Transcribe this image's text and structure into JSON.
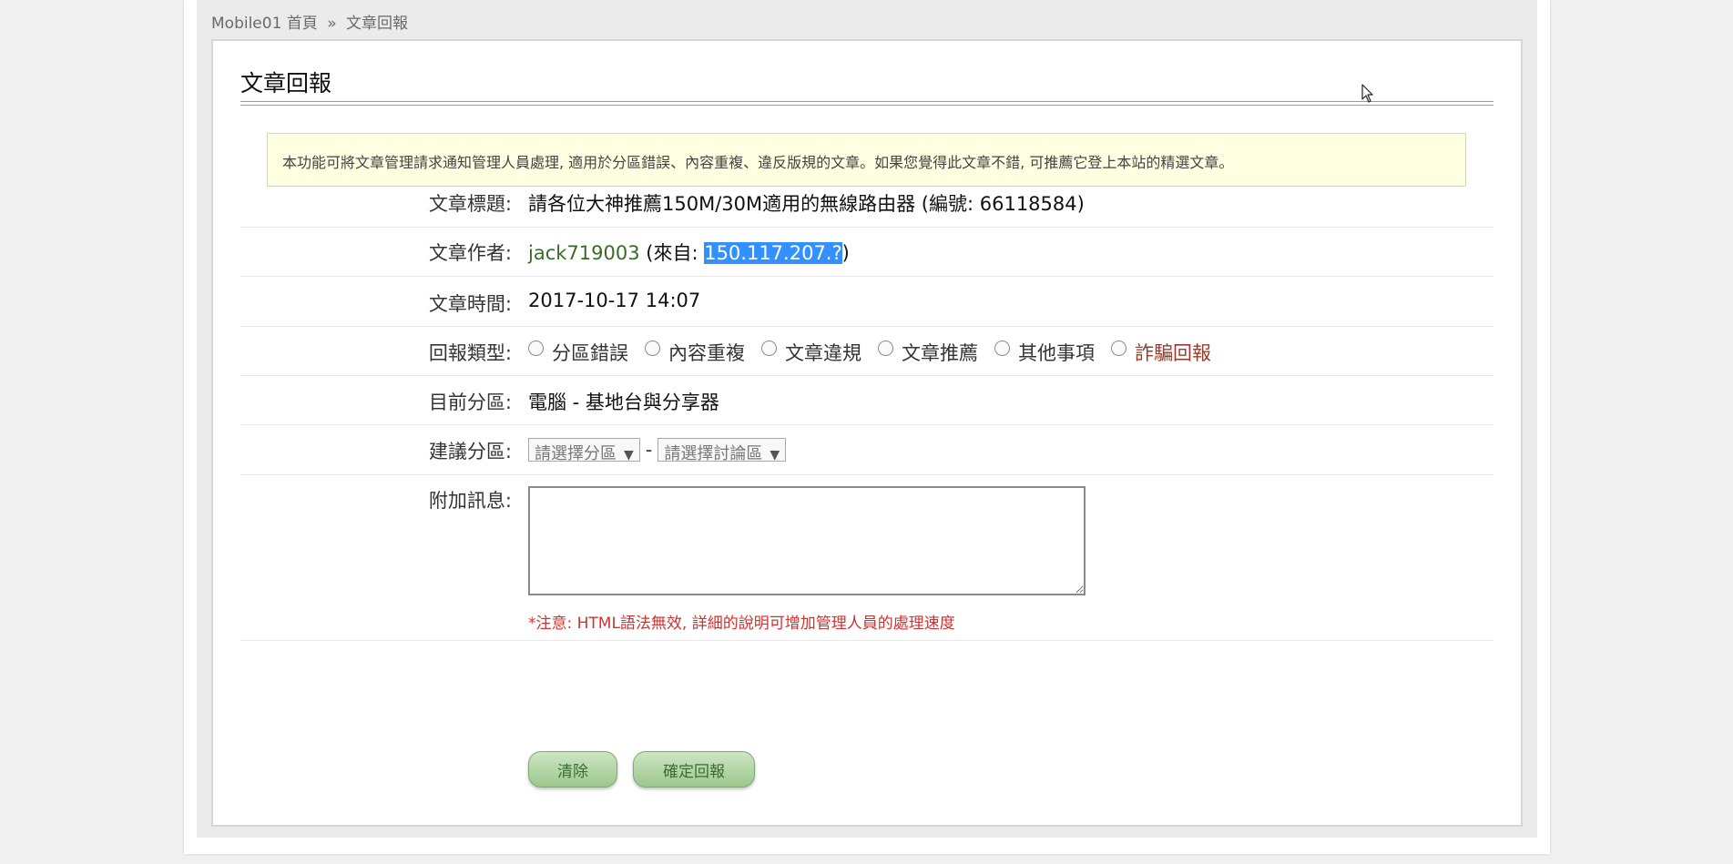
{
  "breadcrumb": {
    "site": "Mobile01",
    "home": "首頁",
    "separator": "»",
    "current": "文章回報"
  },
  "card": {
    "title": "文章回報",
    "notice": "本功能可將文章管理請求通知管理人員處理, 適用於分區錯誤、內容重複、違反版規的文章。如果您覺得此文章不錯, 可推薦它登上本站的精選文章。"
  },
  "fields": {
    "title_label": "文章標題:",
    "title_value": "請各位大神推薦150M/30M適用的無線路由器 (編號: 66118584)",
    "author_label": "文章作者:",
    "author_name": "jack719003",
    "author_from_prefix": " (來自: ",
    "author_ip": "150.117.207.?",
    "author_from_suffix": ")",
    "time_label": "文章時間:",
    "time_value": "2017-10-17 14:07",
    "type_label": "回報類型:",
    "type_options": [
      "分區錯誤",
      "內容重複",
      "文章違規",
      "文章推薦",
      "其他事項",
      "詐騙回報"
    ],
    "current_forum_label": "目前分區:",
    "current_forum_value": "電腦 - 基地台與分享器",
    "suggest_label": "建議分區:",
    "suggest_select1": "請選擇分區",
    "suggest_dash": "-",
    "suggest_select2": "請選擇討論區",
    "message_label": "附加訊息:",
    "message_value": "",
    "note": "*注意: HTML語法無效, 詳細的說明可增加管理人員的處理速度"
  },
  "buttons": {
    "clear": "清除",
    "submit": "確定回報"
  },
  "colors": {
    "page_bg": "#f0f0f0",
    "notice_bg": "#fefee0",
    "author_link": "#3a6a2a",
    "note_red": "#d03232",
    "button_green": "#9cc78e",
    "selection_blue": "#3390ff"
  }
}
